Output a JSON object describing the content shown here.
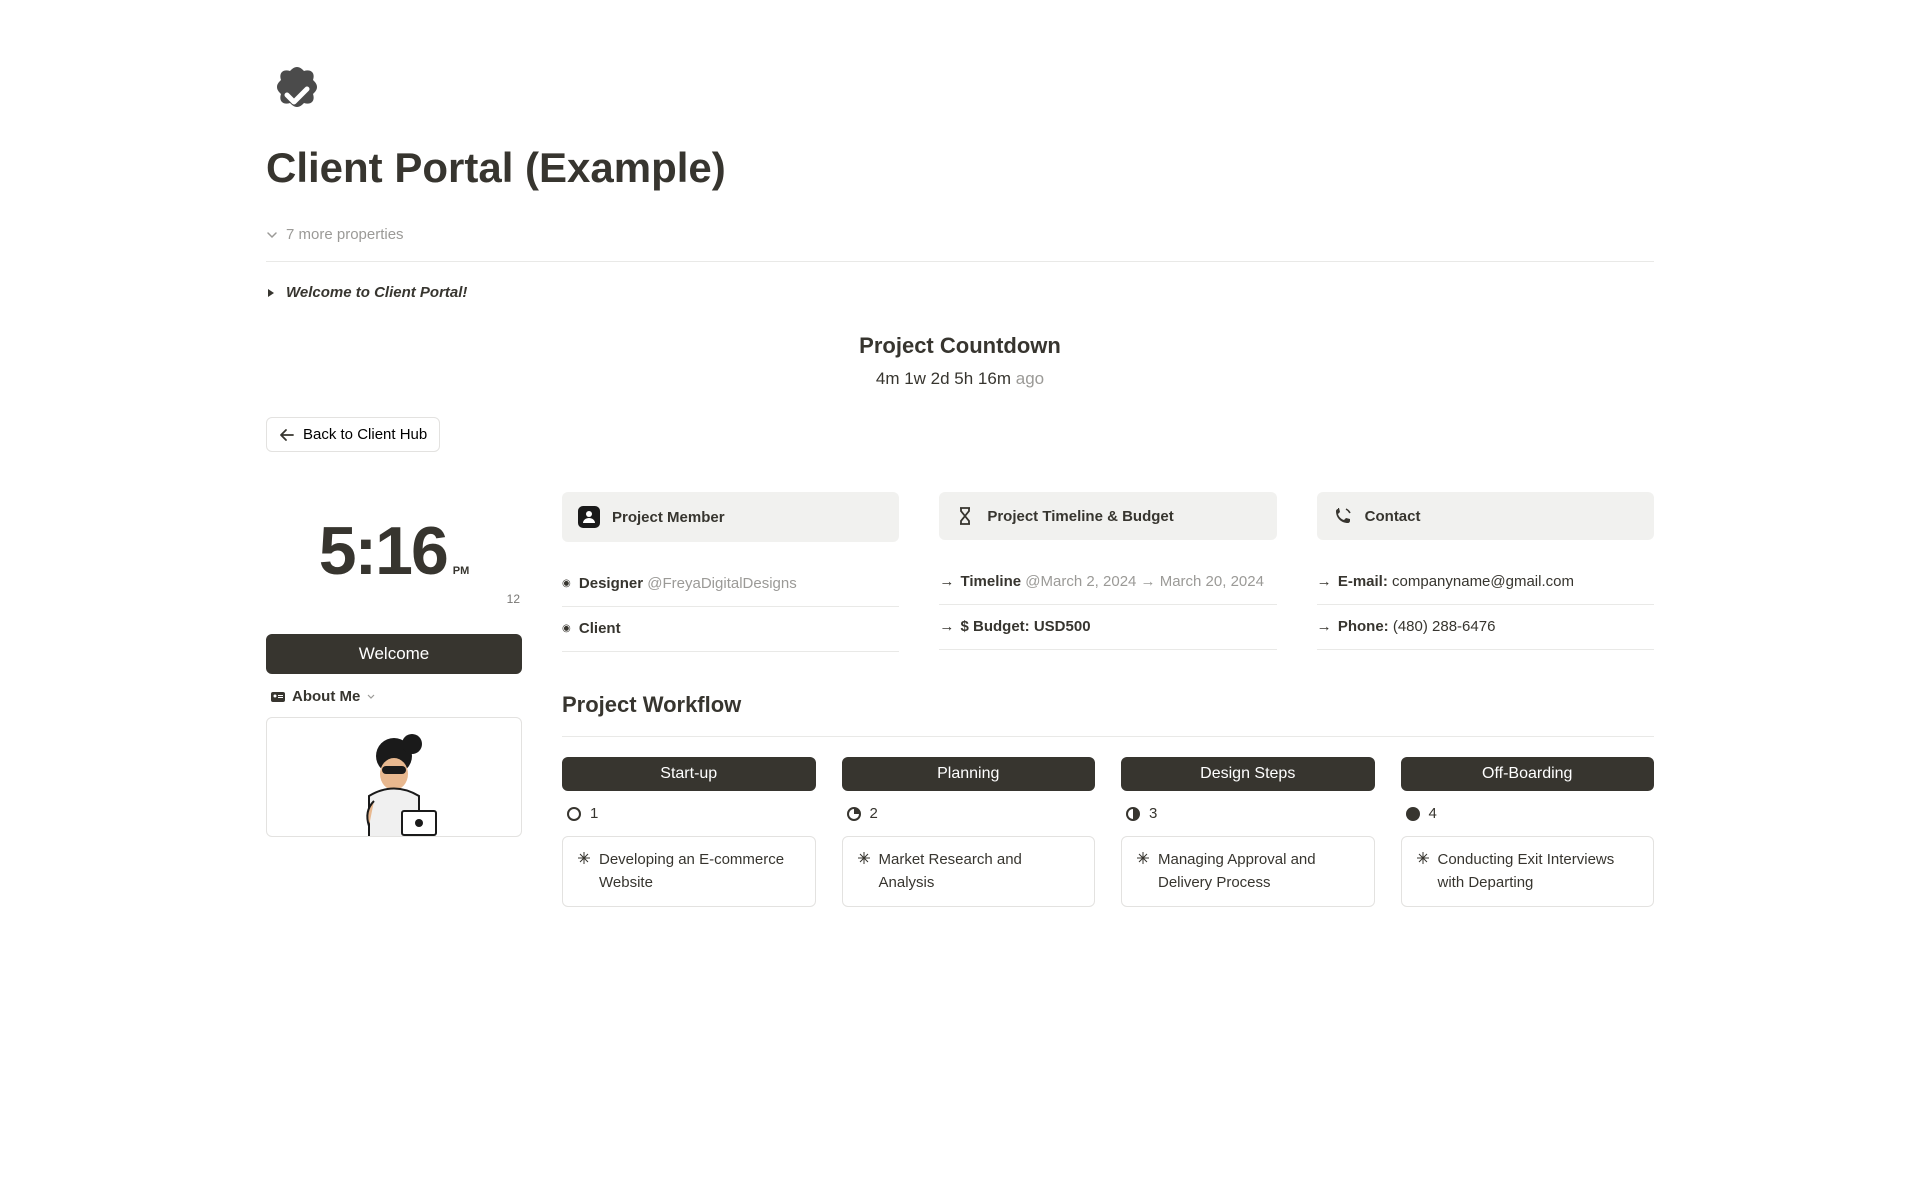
{
  "page_title": "Client Portal (Example)",
  "more_properties": "7 more properties",
  "toggle_welcome": "Welcome to Client Portal!",
  "countdown": {
    "title": "Project Countdown",
    "value": "4m 1w 2d 5h 16m",
    "suffix": "ago"
  },
  "back_button": "Back to Client Hub",
  "clock": {
    "time": "5:16",
    "period": "PM",
    "date": "12"
  },
  "welcome_bar": "Welcome",
  "about_me": "About Me",
  "info_cards": {
    "member": {
      "title": "Project Member",
      "designer_label": "Designer",
      "designer_handle": "@FreyaDigitalDesigns",
      "client_label": "Client"
    },
    "timeline": {
      "title": "Project Timeline & Budget",
      "timeline_label": "Timeline",
      "timeline_value": "@March 2, 2024 → March 20, 2024",
      "budget_label": "$ Budget:",
      "budget_value": "USD500"
    },
    "contact": {
      "title": "Contact",
      "email_label": "E-mail:",
      "email_value": "companyname@gmail.com",
      "phone_label": "Phone:",
      "phone_value": "(480) 288-6476"
    }
  },
  "workflow": {
    "title": "Project Workflow",
    "stages": [
      {
        "name": "Start-up",
        "num": "1",
        "card": "Developing an E-commerce Website"
      },
      {
        "name": "Planning",
        "num": "2",
        "card": "Market Research and Analysis"
      },
      {
        "name": "Design Steps",
        "num": "3",
        "card": "Managing Approval and Delivery Process"
      },
      {
        "name": "Off-Boarding",
        "num": "4",
        "card": "Conducting Exit Interviews with Departing"
      }
    ]
  }
}
